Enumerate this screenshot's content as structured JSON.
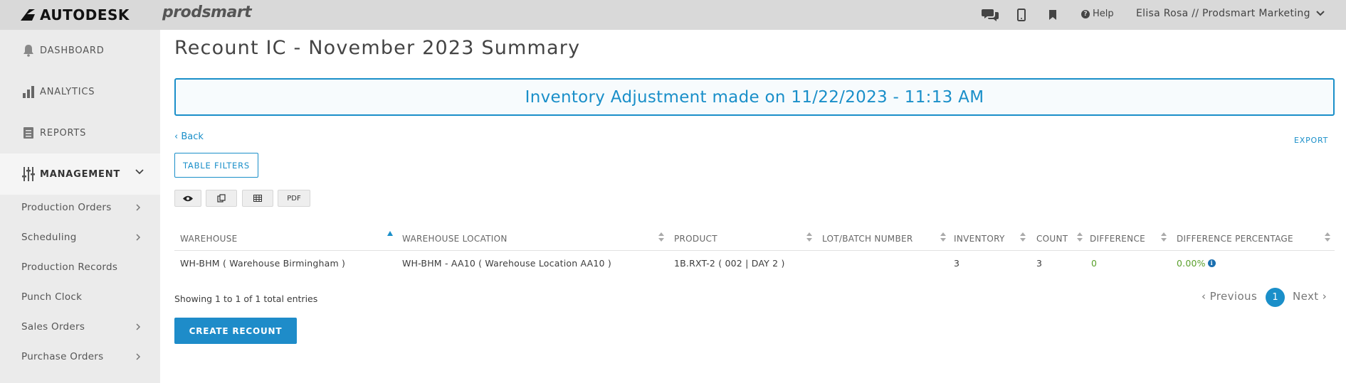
{
  "topbar": {
    "brand": "AUTODESK",
    "product": "prodsmart",
    "help_label": "Help",
    "user_label": "Elisa Rosa // Prodsmart Marketing",
    "icons": [
      "chat-icon",
      "mobile-icon",
      "bookmark-icon",
      "help-icon",
      "chevron-down-icon"
    ]
  },
  "sidebar": {
    "main_items": [
      {
        "label": "DASHBOARD",
        "icon": "bell-icon"
      },
      {
        "label": "ANALYTICS",
        "icon": "bar-chart-icon"
      },
      {
        "label": "REPORTS",
        "icon": "document-icon"
      },
      {
        "label": "MANAGEMENT",
        "icon": "sliders-icon",
        "expanded": true
      }
    ],
    "sub_items": [
      {
        "label": "Production Orders",
        "has_chevron": true
      },
      {
        "label": "Scheduling",
        "has_chevron": true
      },
      {
        "label": "Production Records",
        "has_chevron": false
      },
      {
        "label": "Punch Clock",
        "has_chevron": false
      },
      {
        "label": "Sales Orders",
        "has_chevron": true
      },
      {
        "label": "Purchase Orders",
        "has_chevron": true
      }
    ]
  },
  "main": {
    "title": "Recount IC - November 2023 Summary",
    "banner": "Inventory Adjustment made on 11/22/2023 - 11:13 AM",
    "back_label": "Back",
    "export_label": "EXPORT",
    "filters_label": "TABLE FILTERS",
    "tools": {
      "view_icon": "eye-icon",
      "copy_icon": "copy-icon",
      "table_icon": "table-icon",
      "pdf_label": "PDF"
    },
    "table": {
      "columns": [
        "WAREHOUSE",
        "WAREHOUSE LOCATION",
        "PRODUCT",
        "LOT/BATCH NUMBER",
        "INVENTORY",
        "COUNT",
        "DIFFERENCE",
        "DIFFERENCE PERCENTAGE"
      ],
      "rows": [
        {
          "warehouse": "WH-BHM ( Warehouse Birmingham )",
          "location": "WH-BHM - AA10 ( Warehouse Location AA10 )",
          "product": "1B.RXT-2 ( 002 | DAY 2 )",
          "lot": "",
          "inventory": "3",
          "count": "3",
          "difference": "0",
          "difference_pct": "0.00%"
        }
      ]
    },
    "entries_text": "Showing 1 to 1 of 1 total entries",
    "pagination": {
      "prev": "Previous",
      "page": "1",
      "next": "Next"
    },
    "create_label": "CREATE RECOUNT"
  },
  "colors": {
    "accent": "#1a8fc9",
    "topbar_bg": "#d9d9d9",
    "sidebar_bg": "#ebebeb",
    "positive": "#5aa02c"
  }
}
